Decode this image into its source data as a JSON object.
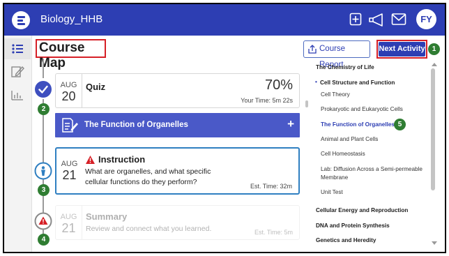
{
  "header": {
    "app_title": "Biology_HHB",
    "avatar_initials": "FY",
    "bar_color": "#2d3eb3"
  },
  "page": {
    "title": "Course Map",
    "course_report_label": "Course Report",
    "next_activity_label": "Next Activity",
    "next_activity_badge": "1"
  },
  "timeline": [
    {
      "badge": "2",
      "status": "completed",
      "month": "AUG",
      "day": "20",
      "title": "Quiz",
      "score": "70%",
      "meta": "Your Time: 5m 22s"
    },
    {
      "kind": "section",
      "title": "The Function of Organelles",
      "action": "+"
    },
    {
      "badge": "3",
      "status": "current",
      "month": "AUG",
      "day": "21",
      "title": "Instruction",
      "description": "What are organelles, and what specific cellular functions do they perform?",
      "meta": "Est. Time: 32m"
    },
    {
      "badge": "4",
      "status": "warning",
      "month": "AUG",
      "day": "21",
      "title": "Summary",
      "description": "Review and connect what you learned.",
      "meta": "Est. Time: 5m"
    }
  ],
  "outline": {
    "items": [
      {
        "label": "The Chemistry of Life",
        "level": "unit"
      },
      {
        "label": "Cell Structure and Function",
        "level": "unit",
        "bullet": "•"
      },
      {
        "label": "Cell Theory",
        "level": "lesson"
      },
      {
        "label": "Prokaryotic and Eukaryotic Cells",
        "level": "lesson"
      },
      {
        "label": "The Function of Organelles",
        "level": "lesson",
        "active": true,
        "badge": "5"
      },
      {
        "label": "Animal and Plant Cells",
        "level": "lesson"
      },
      {
        "label": "Cell Homeostasis",
        "level": "lesson"
      },
      {
        "label": "Lab: Diffusion Across a Semi-permeable",
        "level": "lesson"
      },
      {
        "label": "Membrane",
        "level": "lesson-cont"
      },
      {
        "label": "Unit Test",
        "level": "lesson"
      },
      {
        "label": "Cellular Energy and Reproduction",
        "level": "unit"
      },
      {
        "label": "DNA and Protein Synthesis",
        "level": "unit"
      },
      {
        "label": "Genetics and Heredity",
        "level": "unit"
      }
    ]
  },
  "colors": {
    "accent": "#2d3eb3",
    "section_bar": "#4a59c8",
    "badge_green": "#2f7d32",
    "highlight_red": "#d61f26",
    "warning_red": "#d61f26"
  },
  "icons": {
    "header": [
      "plus-square-icon",
      "megaphone-icon",
      "mail-icon"
    ],
    "rail": [
      "list-icon",
      "edit-icon",
      "bar-chart-icon"
    ]
  }
}
